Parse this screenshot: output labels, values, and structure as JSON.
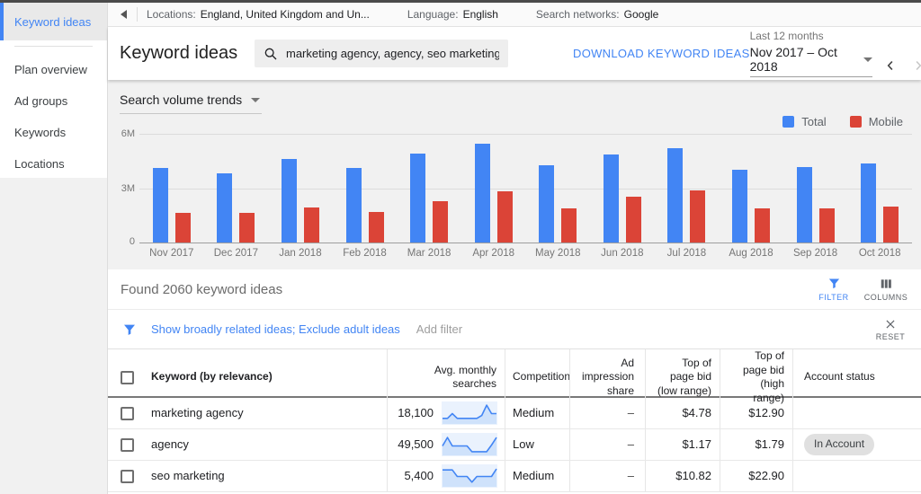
{
  "colors": {
    "accent_blue": "#4285f4",
    "bar_red": "#db4437"
  },
  "sidebar": {
    "items": [
      {
        "label": "Keyword ideas",
        "active": true
      },
      {
        "label": "Plan overview",
        "active": false
      },
      {
        "label": "Ad groups",
        "active": false
      },
      {
        "label": "Keywords",
        "active": false
      },
      {
        "label": "Locations",
        "active": false
      }
    ]
  },
  "topbar": {
    "locations_label": "Locations:",
    "locations_value": "England, United Kingdom and Un...",
    "language_label": "Language:",
    "language_value": "English",
    "networks_label": "Search networks:",
    "networks_value": "Google"
  },
  "header": {
    "title": "Keyword ideas",
    "search_value": "marketing agency, agency, seo marketing",
    "download_label": "DOWNLOAD KEYWORD IDEAS",
    "range_label": "Last 12 months",
    "range_value": "Nov 2017 – Oct 2018"
  },
  "chart": {
    "dropdown_label": "Search volume trends",
    "y_ticks": [
      "6M",
      "3M",
      "0"
    ],
    "legend": [
      {
        "label": "Total",
        "color": "#4285f4"
      },
      {
        "label": "Mobile",
        "color": "#db4437"
      }
    ]
  },
  "chart_data": {
    "type": "bar",
    "title": "Search volume trends",
    "categories": [
      "Nov 2017",
      "Dec 2017",
      "Jan 2018",
      "Feb 2018",
      "Mar 2018",
      "Apr 2018",
      "May 2018",
      "Jun 2018",
      "Jul 2018",
      "Aug 2018",
      "Sep 2018",
      "Oct 2018"
    ],
    "series": [
      {
        "name": "Total",
        "color": "#4285f4",
        "values": [
          4.1,
          3.8,
          4.6,
          4.1,
          4.9,
          5.45,
          4.25,
          4.85,
          5.2,
          4.0,
          4.15,
          4.35
        ]
      },
      {
        "name": "Mobile",
        "color": "#db4437",
        "values": [
          1.65,
          1.65,
          1.95,
          1.7,
          2.3,
          2.85,
          1.9,
          2.55,
          2.9,
          1.9,
          1.9,
          2.0
        ]
      }
    ],
    "units": "millions of monthly searches",
    "xlabel": "",
    "ylabel": "",
    "ylim": [
      0,
      6
    ],
    "y_tick_labels": [
      "0",
      "3M",
      "6M"
    ],
    "grid": true,
    "legend_position": "top-right"
  },
  "results": {
    "found_text": "Found 2060 keyword ideas",
    "filter_label": "FILTER",
    "columns_label": "COLUMNS"
  },
  "filterbar": {
    "applied_filters": "Show broadly related ideas; Exclude adult ideas",
    "add_filter_label": "Add filter",
    "reset_label": "RESET"
  },
  "table": {
    "columns": {
      "keyword": "Keyword (by relevance)",
      "avg": "Avg. monthly searches",
      "competition": "Competition",
      "impression": "Ad impression share",
      "low": "Top of page bid (low range)",
      "high": "Top of page bid (high range)",
      "status": "Account status"
    },
    "rows": [
      {
        "keyword": "marketing agency",
        "avg": "18,100",
        "trend": [
          0.25,
          0.25,
          0.5,
          0.25,
          0.25,
          0.25,
          0.25,
          0.25,
          0.4,
          0.95,
          0.5,
          0.5
        ],
        "competition": "Medium",
        "impression": "–",
        "low": "$4.78",
        "high": "$12.90",
        "status": ""
      },
      {
        "keyword": "agency",
        "avg": "49,500",
        "trend": [
          0.45,
          0.9,
          0.45,
          0.45,
          0.45,
          0.45,
          0.15,
          0.15,
          0.15,
          0.15,
          0.5,
          0.9
        ],
        "competition": "Low",
        "impression": "–",
        "low": "$1.17",
        "high": "$1.79",
        "status": "In Account"
      },
      {
        "keyword": "seo marketing",
        "avg": "5,400",
        "trend": [
          0.85,
          0.85,
          0.85,
          0.5,
          0.5,
          0.5,
          0.2,
          0.5,
          0.5,
          0.5,
          0.5,
          0.9
        ],
        "competition": "Medium",
        "impression": "–",
        "low": "$10.82",
        "high": "$22.90",
        "status": ""
      }
    ]
  }
}
